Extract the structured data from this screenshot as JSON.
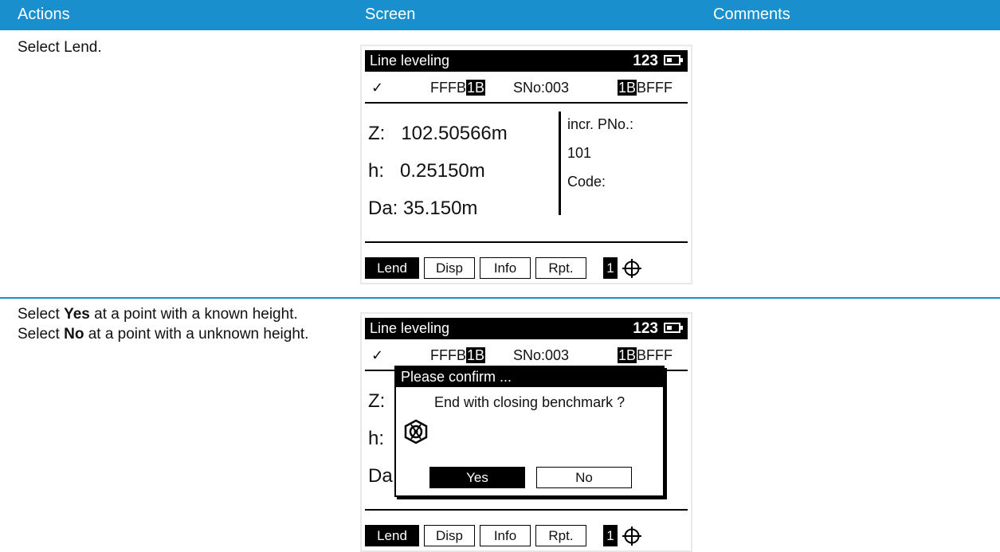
{
  "header": {
    "actions": "Actions",
    "screen": "Screen",
    "comments": "Comments"
  },
  "steps": [
    {
      "action_text": "Select Lend.",
      "screen": {
        "title": "Line leveling",
        "mode": "123",
        "check": "✓",
        "seq_left": "FFFB",
        "seq_left_hl": "1B",
        "sno": "SNo:003",
        "seq_right_hl": "1B",
        "seq_right": "BFFF",
        "z": "Z:   102.50566m",
        "h": "h:   0.25150m",
        "da": "Da: 35.150m",
        "incr_label": "incr. PNo.:",
        "incr_value": "101",
        "code_label": "Code:",
        "softkeys": [
          "Lend",
          "Disp",
          "Info",
          "Rpt."
        ],
        "page": "1"
      }
    },
    {
      "action_prefix": "Select ",
      "action_yes": "Yes",
      "action_mid": " at a point with a known height. Select ",
      "action_no": "No",
      "action_suffix": " at a point with a unknown height.",
      "screen": {
        "title": "Line leveling",
        "mode": "123",
        "check": "✓",
        "seq_left": "FFFB",
        "seq_left_hl": "1B",
        "sno": "SNo:003",
        "seq_right_hl": "1B",
        "seq_right": "BFFF",
        "z_short": "Z:",
        "h_short": "h:",
        "da_short": "Da",
        "dialog_title": "Please confirm ...",
        "dialog_message": "End with closing benchmark ?",
        "yes_label": "Yes",
        "no_label": "No",
        "softkeys": [
          "Lend",
          "Disp",
          "Info",
          "Rpt."
        ],
        "page": "1"
      }
    }
  ],
  "colors": {
    "header_bg": "#1a8fcd",
    "lcd_bg": "#ffffff",
    "lcd_fg": "#000000"
  },
  "icons": [
    "battery-icon",
    "crosshair-icon",
    "instrument-logo-icon"
  ]
}
